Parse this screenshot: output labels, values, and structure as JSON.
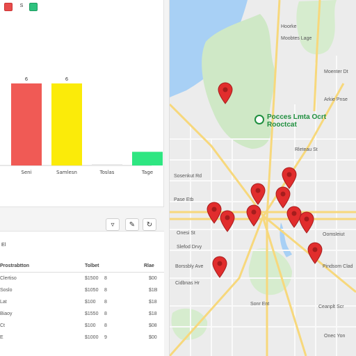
{
  "toolbar": {
    "mid_label": "S"
  },
  "chart_data": {
    "type": "bar",
    "categories": [
      "Seni",
      "Samlesn",
      "Toslas",
      "Tage"
    ],
    "values": [
      6,
      6,
      0,
      1
    ],
    "value_labels": [
      "6",
      "6",
      "",
      ""
    ],
    "colors": [
      "#f05a55",
      "#fbeb09",
      "#e9e9e9",
      "#2ee681"
    ],
    "title": "",
    "xlabel": "",
    "ylabel": ""
  },
  "table": {
    "section_label": "El",
    "headers": [
      "Prostrabtton",
      "Tolbet",
      "Rlae"
    ],
    "rows": [
      {
        "name": "Clertiso",
        "value": "$1500",
        "flag": "8",
        "amount": "$00"
      },
      {
        "name": "Soslo",
        "value": "$1050",
        "flag": "8",
        "amount": "$1B"
      },
      {
        "name": "Lat",
        "value": "$100",
        "flag": "8",
        "amount": "$18"
      },
      {
        "name": "Biaoy",
        "value": "$1550",
        "flag": "8",
        "amount": "$18"
      },
      {
        "name": "Ct",
        "value": "$100",
        "flag": "8",
        "amount": "$08"
      },
      {
        "name": "E",
        "value": "$1000",
        "flag": "9",
        "amount": "$00"
      }
    ]
  },
  "map": {
    "poi_name": "Pocces Lmta Ocrt Rooctcat",
    "street_labels": [
      "Hoorke",
      "Moobtes Lage",
      "Moenter Dt",
      "Arkie Pnse",
      "Rleteau St",
      "Sosenkut Rd",
      "Pase Etb",
      "Onesi St",
      "Slefod Drvy",
      "Borssbly Ave",
      "Cidbnas Hr",
      "Sonr Ent",
      "Oomsleiut",
      "Pindsom Clad",
      "Ceanplt Scr",
      "Onec Yon"
    ]
  }
}
